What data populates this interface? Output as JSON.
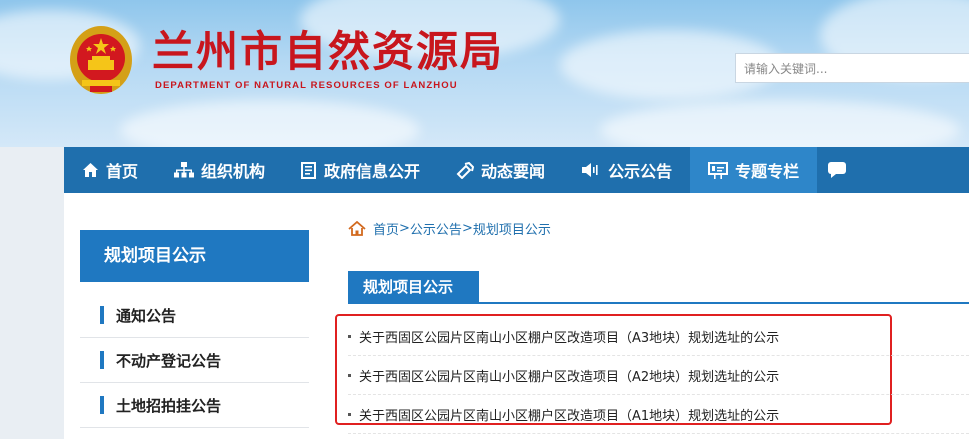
{
  "header": {
    "title": "兰州市自然资源局",
    "subtitle": "DEPARTMENT OF NATURAL RESOURCES OF LANZHOU",
    "search_placeholder": "请输入关键词..."
  },
  "nav": {
    "items": [
      {
        "label": "首页",
        "icon": "home-icon"
      },
      {
        "label": "组织机构",
        "icon": "org-chart-icon"
      },
      {
        "label": "政府信息公开",
        "icon": "document-icon"
      },
      {
        "label": "动态要闻",
        "icon": "news-icon"
      },
      {
        "label": "公示公告",
        "icon": "speaker-icon"
      },
      {
        "label": "专题专栏",
        "icon": "presentation-icon"
      }
    ],
    "active_index": 5
  },
  "sidebar": {
    "title": "规划项目公示",
    "items": [
      {
        "label": "通知公告"
      },
      {
        "label": "不动产登记公告"
      },
      {
        "label": "土地招拍挂公告"
      }
    ]
  },
  "breadcrumb": {
    "home": "首页",
    "level1": "公示公告",
    "level2": "规划项目公示",
    "separator": ">"
  },
  "main": {
    "section_title": "规划项目公示",
    "articles": [
      {
        "title": "关于西固区公园片区南山小区棚户区改造项目（A3地块）规划选址的公示"
      },
      {
        "title": "关于西固区公园片区南山小区棚户区改造项目（A2地块）规划选址的公示"
      },
      {
        "title": "关于西固区公园片区南山小区棚户区改造项目（A1地块）规划选址的公示"
      }
    ]
  },
  "colors": {
    "brand_red": "#c8161d",
    "nav_blue": "#1f6fad",
    "active_blue": "#2e86c9",
    "highlight_red": "#e02020"
  }
}
